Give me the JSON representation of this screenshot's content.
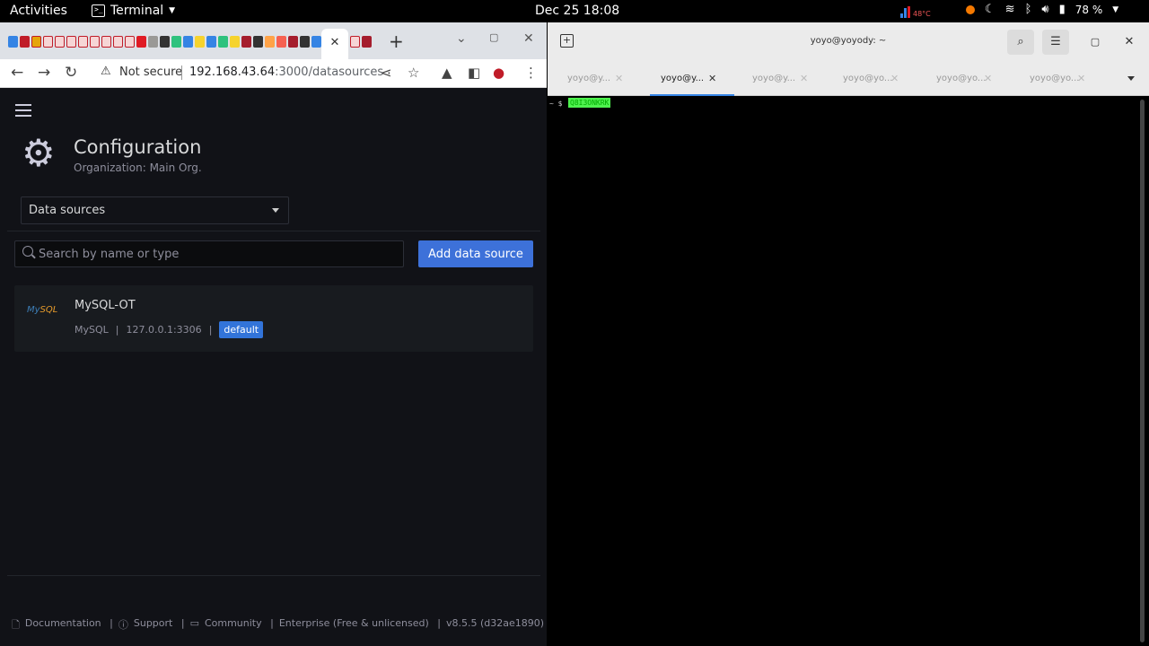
{
  "topbar": {
    "activities": "Activities",
    "app_name": "Terminal",
    "clock": "Dec 25  18:08",
    "temperature": "48°C",
    "battery": "78 %"
  },
  "browser": {
    "url_host": "192.168.43.64",
    "url_path": ":3000/datasources",
    "not_secure": "Not secure"
  },
  "grafana": {
    "page_title": "Configuration",
    "page_subtitle": "Organization: Main Org.",
    "section_select": "Data sources",
    "search_placeholder": "Search by name or type",
    "add_button": "Add data source",
    "datasource": {
      "name": "MySQL-OT",
      "type": "MySQL",
      "address": "127.0.0.1:3306",
      "badge": "default",
      "logo_text_a": "My",
      "logo_text_b": "SQL"
    },
    "footer": {
      "documentation": "Documentation",
      "support": "Support",
      "community": "Community",
      "edition": "Enterprise (Free & unlicensed)",
      "version": "v8.5.5 (d32ae1890)"
    }
  },
  "terminal": {
    "window_title": "yoyo@yoyody: ~",
    "tabs": [
      "yoyo@y...",
      "yoyo@y...",
      "yoyo@y...",
      "yoyo@yo...",
      "yoyo@yo...",
      "yoyo@yo..."
    ],
    "prompt": "~ $",
    "command": "Q8I3ONKRK"
  },
  "colors": {
    "grafana_bg": "#111217",
    "primary_button": "#3d71d9",
    "badge": "#3274d9",
    "terminal_highlight": "#4ef14e"
  }
}
